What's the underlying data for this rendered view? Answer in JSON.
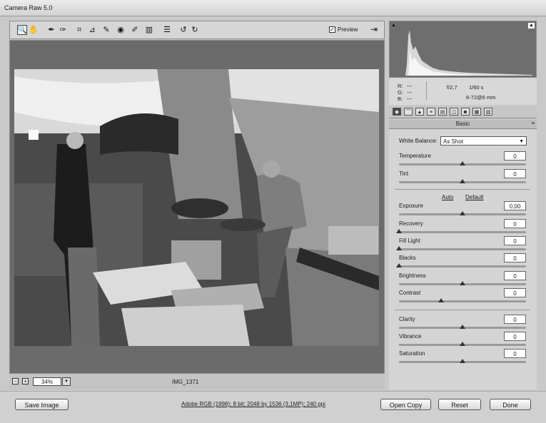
{
  "window": {
    "title": "Camera Raw 5.0"
  },
  "toolbar": {
    "tools": [
      {
        "name": "zoom-tool-icon",
        "glyph": "🔍"
      },
      {
        "name": "hand-tool-icon",
        "glyph": "✋"
      },
      {
        "name": "white-balance-tool-icon",
        "glyph": "✒"
      },
      {
        "name": "color-sampler-tool-icon",
        "glyph": "✑"
      },
      {
        "name": "crop-tool-icon",
        "glyph": "⌗"
      },
      {
        "name": "straighten-tool-icon",
        "glyph": "⊿"
      },
      {
        "name": "spot-removal-tool-icon",
        "glyph": "✎"
      },
      {
        "name": "red-eye-tool-icon",
        "glyph": "◉"
      },
      {
        "name": "adjustment-brush-icon",
        "glyph": "✐"
      },
      {
        "name": "graduated-filter-icon",
        "glyph": "▥"
      },
      {
        "name": "preferences-icon",
        "glyph": "☰"
      },
      {
        "name": "rotate-ccw-icon",
        "glyph": "↺"
      },
      {
        "name": "rotate-cw-icon",
        "glyph": "↻"
      }
    ],
    "preview_label": "Preview",
    "preview_checked": "✓"
  },
  "status": {
    "zoom": "34%",
    "filename": "IMG_1371"
  },
  "readout": {
    "r_label": "R:",
    "g_label": "G:",
    "b_label": "B:",
    "r_val": "---",
    "g_val": "---",
    "b_val": "---",
    "aperture": "f/2,7",
    "shutter": "1/60 s",
    "lens": "6-72@6 mm"
  },
  "panel": {
    "title": "Basic",
    "white_balance_label": "White Balance:",
    "white_balance_value": "As Shot",
    "auto_label": "Auto",
    "default_label": "Default",
    "sliders": [
      {
        "label": "Temperature",
        "value": "0",
        "pos": 0.5
      },
      {
        "label": "Tint",
        "value": "0",
        "pos": 0.5
      },
      {
        "label": "Exposure",
        "value": "0,00",
        "pos": 0.5
      },
      {
        "label": "Recovery",
        "value": "0",
        "pos": 0.0
      },
      {
        "label": "Fill Light",
        "value": "0",
        "pos": 0.0
      },
      {
        "label": "Blacks",
        "value": "0",
        "pos": 0.0
      },
      {
        "label": "Brightness",
        "value": "0",
        "pos": 0.5
      },
      {
        "label": "Contrast",
        "value": "0",
        "pos": 0.33
      },
      {
        "label": "Clarity",
        "value": "0",
        "pos": 0.5
      },
      {
        "label": "Vibrance",
        "value": "0",
        "pos": 0.5
      },
      {
        "label": "Saturation",
        "value": "0",
        "pos": 0.5
      }
    ]
  },
  "footer": {
    "save_label": "Save Image",
    "workflow_link": "Adobe RGB (1998); 8 bit; 2048 by 1536 (3,1MP); 240 ppi",
    "open_label": "Open Copy",
    "reset_label": "Reset",
    "done_label": "Done"
  }
}
